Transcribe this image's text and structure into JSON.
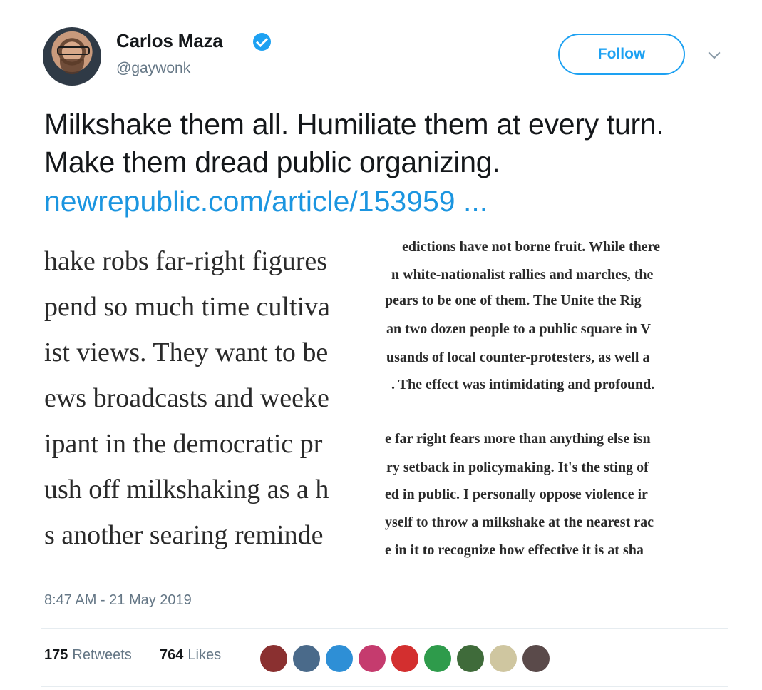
{
  "user": {
    "name": "Carlos Maza",
    "handle": "@gaywonk"
  },
  "header": {
    "follow_label": "Follow"
  },
  "tweet": {
    "text": "Milkshake them all. Humiliate them at every turn. Make them dread public organizing.",
    "link": "newrepublic.com/article/153959 ..."
  },
  "clipping": {
    "left_lines": [
      "hake robs far-right figures",
      "pend so much time cultiva",
      "ist views. They want to be",
      "ews broadcasts and weeke",
      "ipant in the democratic pr",
      "ush off milkshaking as a h",
      "s another searing reminde"
    ],
    "right_lines": [
      "edictions have not borne fruit. While there",
      "n white-nationalist rallies and marches, the",
      "pears to be one of them. The Unite the Rig",
      "an two dozen people to a public square in V",
      "usands of local counter-protesters, as well a",
      ". The effect was intimidating and profound.",
      "e far right fears more than anything else isn",
      "ry setback in policymaking. It's the sting of",
      "ed in public. I personally oppose violence ir",
      "yself to throw a milkshake at the nearest rac",
      "e in it to recognize how effective it is at sha"
    ]
  },
  "meta": {
    "timestamp": "8:47 AM - 21 May 2019",
    "retweets_count": "175",
    "retweets_label": "Retweets",
    "likes_count": "764",
    "likes_label": "Likes"
  },
  "likers_colors": [
    "#8a3030",
    "#4a6a8a",
    "#2e8fd6",
    "#c53b6e",
    "#d32f2f",
    "#2e9b4b",
    "#3f6b3a",
    "#cfc6a0",
    "#5a4a4a"
  ],
  "colors": {
    "accent": "#1da1f2",
    "link": "#1b95e0",
    "secondary_text": "#657786"
  }
}
